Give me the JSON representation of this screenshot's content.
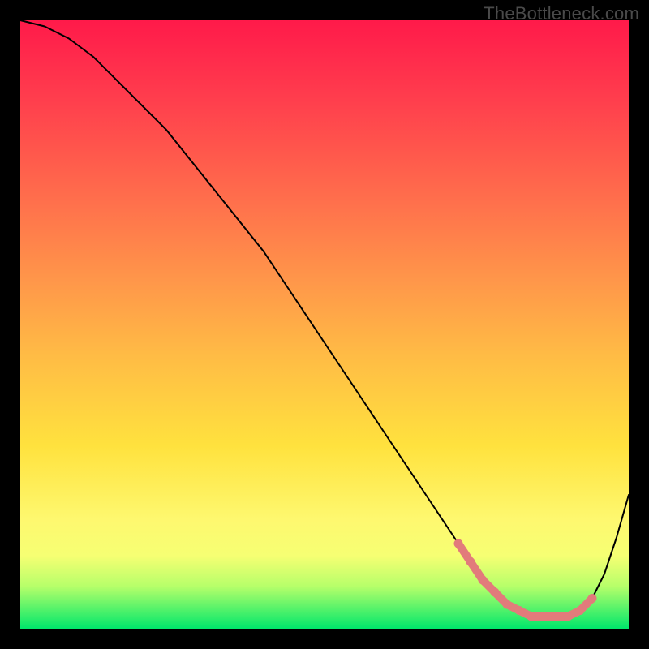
{
  "watermark": "TheBottleneck.com",
  "colors": {
    "curve_stroke": "#000000",
    "accent_marker": "#e27b7b",
    "frame": "#000000"
  },
  "chart_data": {
    "type": "line",
    "title": "",
    "xlabel": "",
    "ylabel": "",
    "xlim": [
      0,
      100
    ],
    "ylim": [
      0,
      100
    ],
    "series": [
      {
        "name": "bottleneck-curve",
        "x": [
          0,
          4,
          8,
          12,
          16,
          20,
          24,
          28,
          32,
          36,
          40,
          44,
          48,
          52,
          56,
          60,
          64,
          68,
          72,
          74,
          76,
          78,
          80,
          82,
          84,
          86,
          88,
          90,
          92,
          94,
          96,
          98,
          100
        ],
        "y": [
          100,
          99,
          97,
          94,
          90,
          86,
          82,
          77,
          72,
          67,
          62,
          56,
          50,
          44,
          38,
          32,
          26,
          20,
          14,
          11,
          8,
          6,
          4,
          3,
          2,
          2,
          2,
          2,
          3,
          5,
          9,
          15,
          22
        ]
      }
    ],
    "accent_segment": {
      "name": "highlighted-optimal-range",
      "x": [
        72,
        74,
        76,
        78,
        80,
        82,
        84,
        86,
        88,
        90,
        92,
        94
      ],
      "y": [
        14,
        11,
        8,
        6,
        4,
        3,
        2,
        2,
        2,
        2,
        3,
        5
      ]
    }
  }
}
